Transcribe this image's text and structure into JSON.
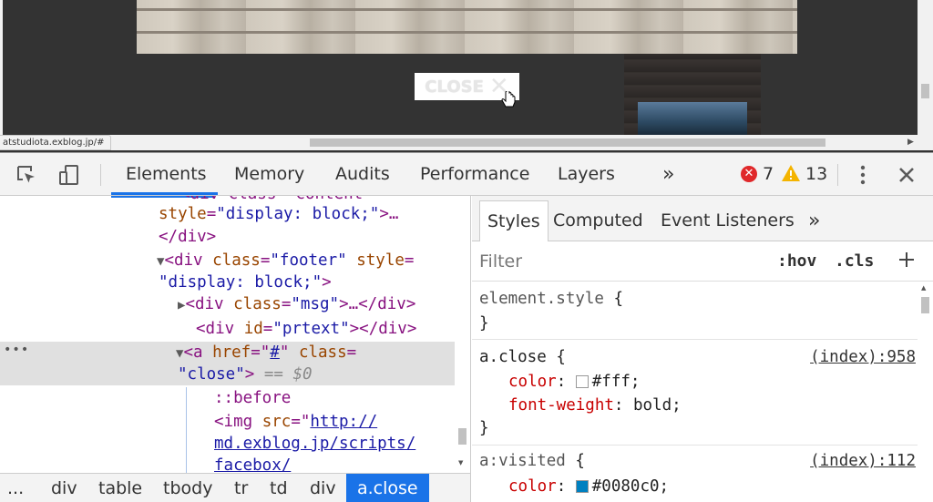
{
  "viewport": {
    "close_label": "CLOSE",
    "close_glyph": "✕",
    "status_url": "atstudiota.exblog.jp/#"
  },
  "toolbar": {
    "tabs": [
      "Elements",
      "Memory",
      "Audits",
      "Performance",
      "Layers"
    ],
    "more": "»",
    "errors": "7",
    "warnings": "13",
    "colors": {
      "accent": "#1a73e8",
      "error": "#e0282a",
      "warning": "#f4b400"
    }
  },
  "dom": {
    "line1": {
      "text": "<div class=\"content\""
    },
    "line2": {
      "attr": "style",
      "val": "\"display: block;\"",
      "close": ">…"
    },
    "line3": {
      "text": "</div>"
    },
    "line4": {
      "open": "<div",
      "attr1": "class",
      "val1": "\"footer\"",
      "attr2": "style",
      "eq": "="
    },
    "line5": {
      "val": "\"display: block;\"",
      "close": ">"
    },
    "line6": {
      "open": "<div",
      "attr": "class",
      "val": "\"msg\"",
      "rest": ">…</div>"
    },
    "line7": {
      "open": "<div",
      "attr": "id",
      "val": "\"prtext\"",
      "rest": "></div>"
    },
    "line8": {
      "open": "<a",
      "attr1": "href",
      "val1": "#",
      "attr2": "class",
      "eq": "="
    },
    "line9": {
      "val": "\"close\"",
      "close": ">",
      "marker": "== $0"
    },
    "line10": {
      "text": "::before"
    },
    "line11": {
      "open": "<img",
      "attr": "src",
      "link1": "http://"
    },
    "line12": {
      "link2": "md.exblog.jp/scripts/"
    },
    "line13": {
      "link3": "facebox/"
    },
    "ellipsis": "•••"
  },
  "breadcrumb": {
    "items": [
      "...",
      "div",
      "table",
      "tbody",
      "tr",
      "td",
      "div"
    ],
    "active": "a.close"
  },
  "styles": {
    "tabs": [
      "Styles",
      "Computed",
      "Event Listeners"
    ],
    "more": "»",
    "filter_placeholder": "Filter",
    "hov": ":hov",
    "cls": ".cls",
    "add": "+",
    "rules": {
      "element_style": {
        "selector": "element.style",
        "open": "{",
        "close": "}"
      },
      "a_close": {
        "selector": "a.close",
        "open": "{",
        "close": "}",
        "source": "(index):958",
        "p1_name": "color",
        "p1_value": "#fff;",
        "p1_swatch": "#ffffff",
        "p2_name": "font-weight",
        "p2_value": "bold;"
      },
      "a_visited": {
        "selector": "a:visited",
        "open": "{",
        "source": "(index):112",
        "p1_name": "color",
        "p1_value": "#0080c0;",
        "p1_swatch": "#0080c0"
      }
    }
  }
}
